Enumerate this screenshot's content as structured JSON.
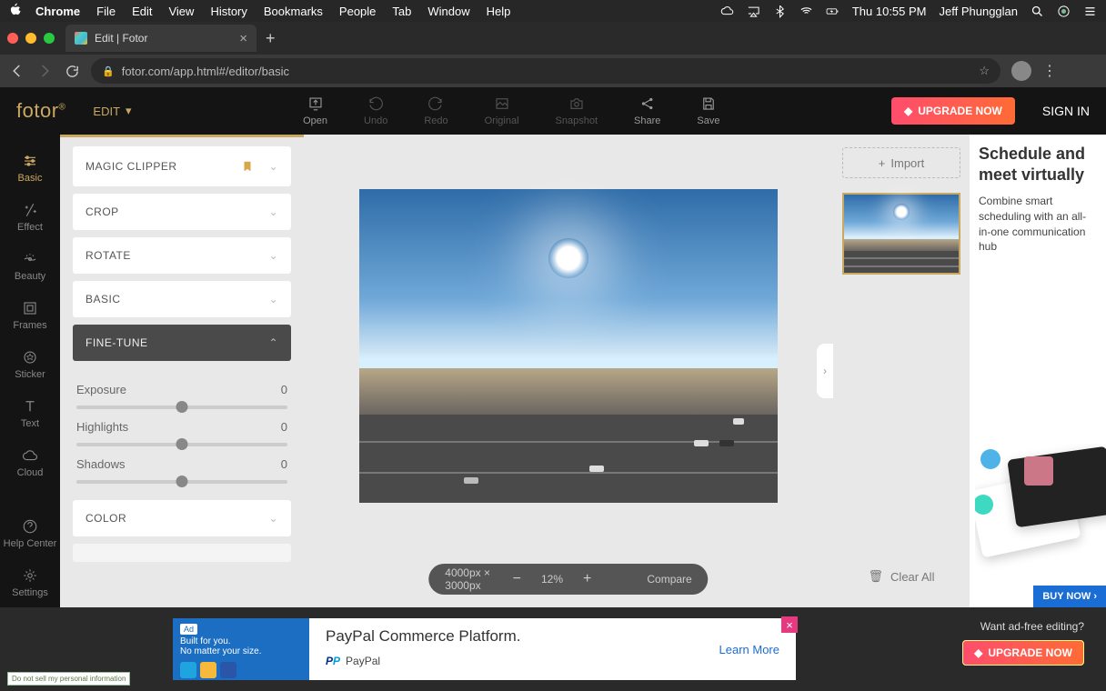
{
  "menubar": {
    "app": "Chrome",
    "items": [
      "File",
      "Edit",
      "View",
      "History",
      "Bookmarks",
      "People",
      "Tab",
      "Window",
      "Help"
    ],
    "clock": "Thu 10:55 PM",
    "user": "Jeff Phungglan"
  },
  "browser": {
    "tab_title": "Edit | Fotor",
    "url": "fotor.com/app.html#/editor/basic"
  },
  "fotor": {
    "logo": "fotor",
    "edit_label": "EDIT",
    "tools": {
      "open": "Open",
      "undo": "Undo",
      "redo": "Redo",
      "original": "Original",
      "snapshot": "Snapshot",
      "share": "Share",
      "save": "Save"
    },
    "upgrade": "UPGRADE NOW",
    "signin": "SIGN IN"
  },
  "rail": {
    "basic": "Basic",
    "effect": "Effect",
    "beauty": "Beauty",
    "frames": "Frames",
    "sticker": "Sticker",
    "text": "Text",
    "cloud": "Cloud",
    "help": "Help Center",
    "settings": "Settings"
  },
  "panel": {
    "magic": "MAGIC CLIPPER",
    "crop": "CROP",
    "rotate": "ROTATE",
    "basic": "BASIC",
    "finetune": "FINE-TUNE",
    "color": "COLOR",
    "sliders": {
      "exposure": {
        "label": "Exposure",
        "value": "0"
      },
      "highlights": {
        "label": "Highlights",
        "value": "0"
      },
      "shadows": {
        "label": "Shadows",
        "value": "0"
      }
    }
  },
  "canvas": {
    "dimensions": "4000px × 3000px",
    "zoom": "12%",
    "compare": "Compare"
  },
  "right": {
    "import": "Import",
    "clear": "Clear All"
  },
  "ad_right": {
    "title": "Schedule and meet virtually",
    "body": "Combine smart scheduling with an all-in-one communication hub",
    "cta": "BUY NOW ›"
  },
  "ad_bottom": {
    "tag": "Ad",
    "line1": "Built for you.",
    "line2": "No matter your size.",
    "headline": "PayPal Commerce Platform.",
    "brand": "PayPal",
    "learn": "Learn More"
  },
  "adfree": {
    "q": "Want ad-free editing?",
    "btn": "UPGRADE NOW"
  },
  "donotsell": "Do not sell my personal information"
}
